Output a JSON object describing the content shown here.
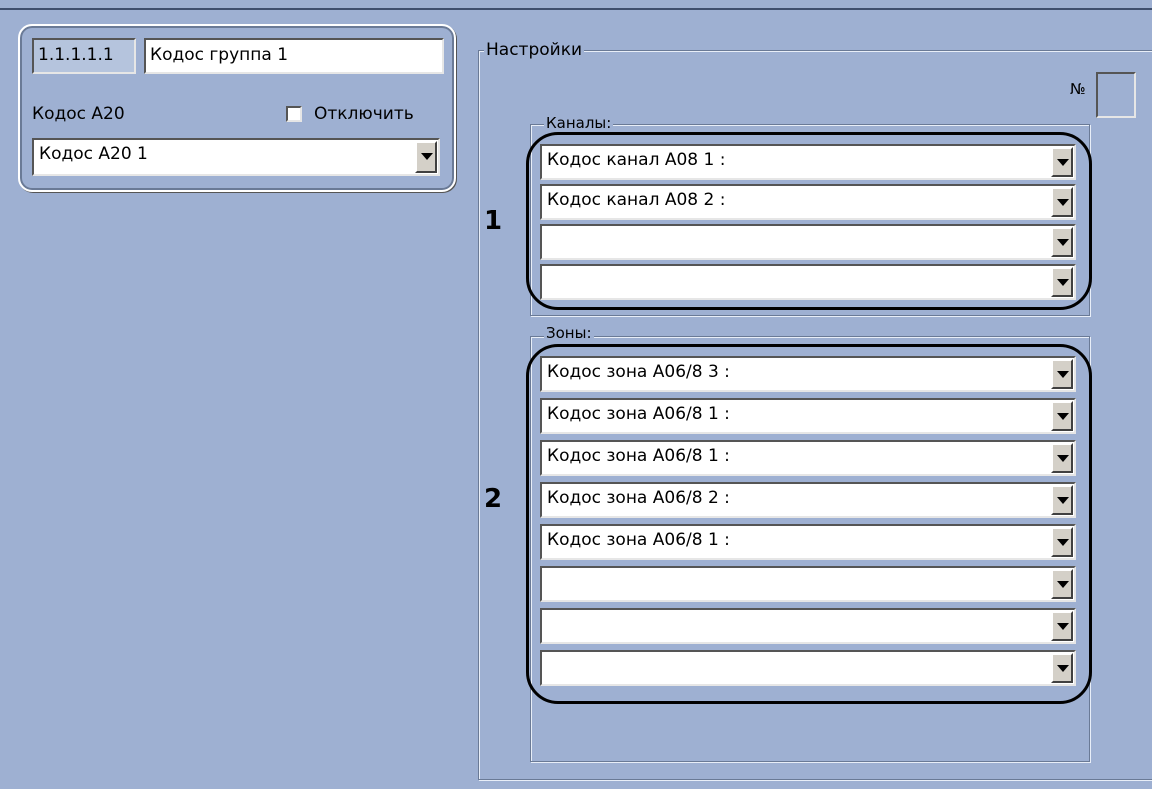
{
  "object": {
    "id": "1.1.1.1.1",
    "name": "Кодос группа 1",
    "parent_label": "Кодос А20",
    "disable_label": "Отключить",
    "parent_selected": "Кодос А20 1"
  },
  "settings": {
    "title": "Настройки",
    "number_label": "№",
    "channels": {
      "title": "Каналы:",
      "items": [
        "Кодос канал А08  1 :",
        "Кодос канал А08  2 :",
        "",
        ""
      ]
    },
    "zones": {
      "title": "Зоны:",
      "items": [
        "Кодос зона А06/8  3 :",
        "Кодос зона А06/8  1 :",
        "Кодос зона А06/8  1 :",
        "Кодос зона А06/8  2 :",
        "Кодос зона А06/8  1 :",
        "",
        "",
        ""
      ]
    }
  },
  "annotations": {
    "marker1": "1",
    "marker2": "2"
  }
}
